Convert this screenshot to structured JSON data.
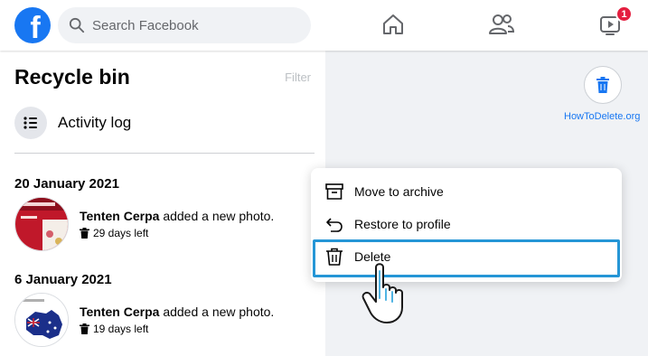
{
  "topbar": {
    "logo_letter": "f",
    "search_placeholder": "Search Facebook",
    "watch_badge": "1"
  },
  "left_panel": {
    "title": "Recycle bin",
    "filter_label": "Filter",
    "activity_log_label": "Activity log",
    "groups": [
      {
        "date": "20 January 2021",
        "author": "Tenten Cerpa",
        "action": " added a new photo.",
        "days_left": "29 days left"
      },
      {
        "date": "6 January 2021",
        "author": "Tenten Cerpa",
        "action": " added a new photo.",
        "days_left": "19 days left"
      }
    ]
  },
  "watermark": "HowToDelete.org",
  "context_menu": {
    "items": [
      {
        "label": "Move to archive",
        "icon": "archive-icon"
      },
      {
        "label": "Restore to profile",
        "icon": "restore-icon"
      },
      {
        "label": "Delete",
        "icon": "trash-icon"
      }
    ]
  },
  "colors": {
    "brand": "#1877f2",
    "highlight": "#2596d6",
    "badge": "#e41e3f",
    "background": "#f0f2f5"
  }
}
